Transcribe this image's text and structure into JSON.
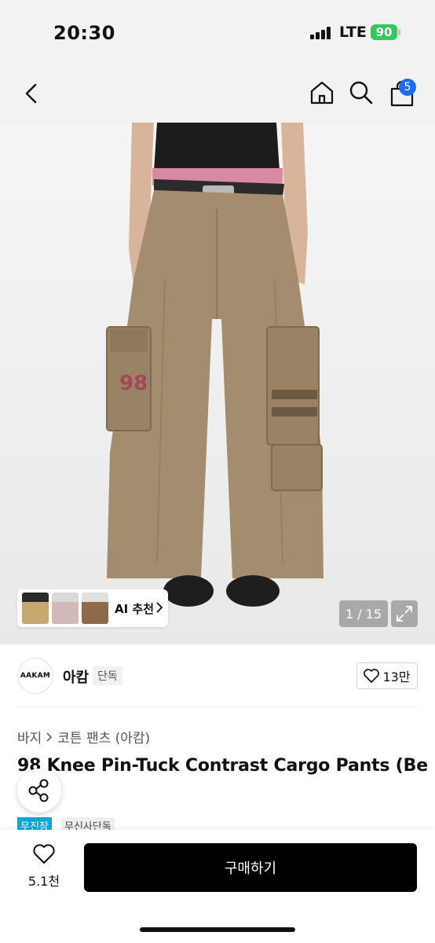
{
  "status_bar": {
    "time": "20:30",
    "network": "LTE",
    "battery": "90"
  },
  "nav": {
    "cart_count": "5"
  },
  "gallery": {
    "ai_label": "AI 추천",
    "pager": "1 / 15"
  },
  "brand": {
    "logo_text": "AAKAM",
    "name": "아캄",
    "tag": "단독",
    "likes": "13만"
  },
  "breadcrumb": {
    "parent": "바지",
    "child": "코튼 팬츠 (아캄)"
  },
  "product": {
    "title": "98 Knee Pin-Tuck Contrast Cargo Pants (Be",
    "badges": [
      "무진장",
      "무신사단독"
    ]
  },
  "bottom_bar": {
    "wish_count": "5.1천",
    "buy_label": "구매하기"
  },
  "colors": {
    "cart_badge": "#1d6cf0",
    "battery": "#34c759",
    "badge_accent": "#0aa6d6",
    "buy_button": "#000000"
  }
}
